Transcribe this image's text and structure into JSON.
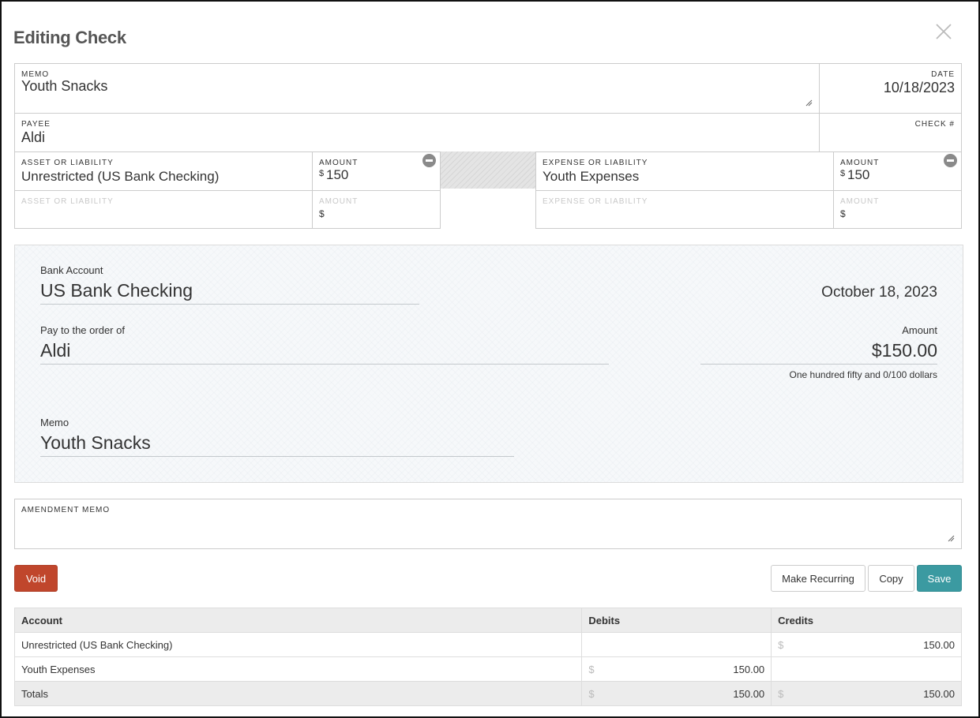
{
  "dialog": {
    "title": "Editing Check"
  },
  "form": {
    "memo_label": "MEMO",
    "memo_value": "Youth Snacks",
    "date_label": "DATE",
    "date_value": "10/18/2023",
    "payee_label": "PAYEE",
    "payee_value": "Aldi",
    "check_label": "CHECK #",
    "check_value": "",
    "left_lines": [
      {
        "account_label": "ASSET OR LIABILITY",
        "account_value": "Unrestricted (US Bank Checking)",
        "amount_label": "AMOUNT",
        "currency": "$",
        "amount_value": "150"
      },
      {
        "account_label": "ASSET OR LIABILITY",
        "account_value": "",
        "amount_label": "AMOUNT",
        "currency": "$",
        "amount_value": ""
      }
    ],
    "right_lines": [
      {
        "account_label": "EXPENSE OR LIABILITY",
        "account_value": "Youth Expenses",
        "amount_label": "AMOUNT",
        "currency": "$",
        "amount_value": "150"
      },
      {
        "account_label": "EXPENSE OR LIABILITY",
        "account_value": "",
        "amount_label": "AMOUNT",
        "currency": "$",
        "amount_value": ""
      }
    ]
  },
  "check_preview": {
    "bank_label": "Bank Account",
    "bank_value": "US Bank Checking",
    "date_value": "October 18, 2023",
    "pay_label": "Pay to the order of",
    "pay_value": "Aldi",
    "amount_label": "Amount",
    "amount_value": "$150.00",
    "amount_words": "One hundred fifty and 0/100 dollars",
    "memo_label": "Memo",
    "memo_value": "Youth Snacks"
  },
  "amendment": {
    "label": "AMENDMENT MEMO",
    "value": ""
  },
  "buttons": {
    "void": "Void",
    "make_recurring": "Make Recurring",
    "copy": "Copy",
    "save": "Save"
  },
  "ledger": {
    "headers": [
      "Account",
      "Debits",
      "Credits"
    ],
    "currency": "$",
    "rows": [
      {
        "account": "Unrestricted (US Bank Checking)",
        "debit": "",
        "credit": "150.00"
      },
      {
        "account": "Youth Expenses",
        "debit": "150.00",
        "credit": ""
      }
    ],
    "totals": {
      "label": "Totals",
      "debit": "150.00",
      "credit": "150.00"
    }
  },
  "colors": {
    "void": "#c0462c",
    "save": "#3b9aa1"
  },
  "icons": {
    "close": "close-icon",
    "remove": "minus-circle-icon",
    "resize": "resize-handle-icon"
  }
}
